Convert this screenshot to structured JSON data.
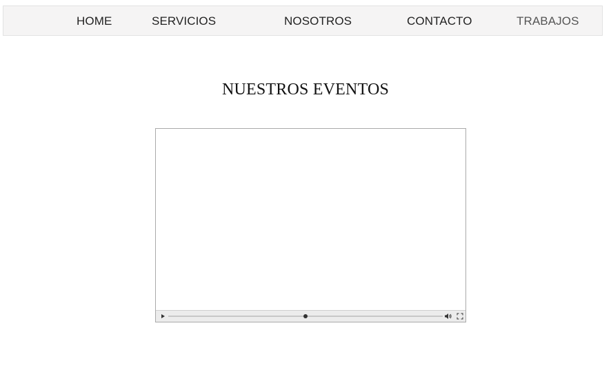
{
  "nav": {
    "items": [
      {
        "label": "HOME"
      },
      {
        "label": "SERVICIOS"
      },
      {
        "label": "NOSOTROS"
      },
      {
        "label": "CONTACTO"
      },
      {
        "label": "TRABAJOS"
      }
    ]
  },
  "main": {
    "title": "NUESTROS EVENTOS"
  },
  "video": {
    "progress": 0.5,
    "icons": {
      "play": "play-icon",
      "volume": "volume-icon",
      "fullscreen": "fullscreen-icon"
    }
  },
  "colors": {
    "nav_background": "#f5f4f4",
    "nav_text": "#222222",
    "controls_background": "#ececec"
  }
}
